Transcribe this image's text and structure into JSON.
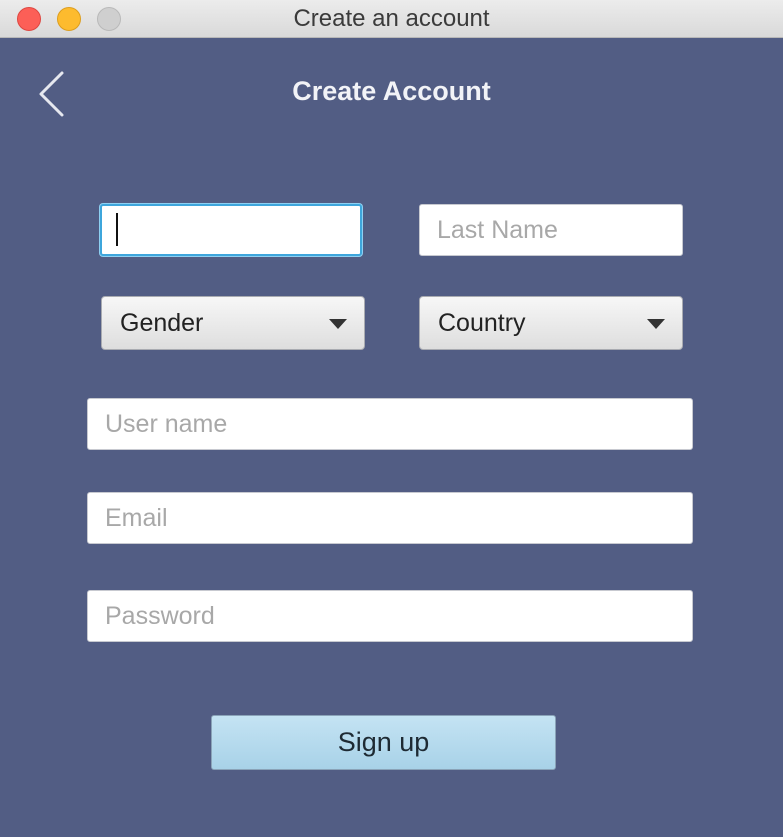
{
  "window": {
    "title": "Create an account"
  },
  "header": {
    "title": "Create Account",
    "back_icon": "chevron-left-icon"
  },
  "form": {
    "first_name": {
      "value": "",
      "placeholder": ""
    },
    "last_name": {
      "value": "",
      "placeholder": "Last Name"
    },
    "gender": {
      "selected": "Gender"
    },
    "country": {
      "selected": "Country"
    },
    "username": {
      "value": "",
      "placeholder": "User name"
    },
    "email": {
      "value": "",
      "placeholder": "Email"
    },
    "password": {
      "value": "",
      "placeholder": "Password"
    },
    "submit_label": "Sign up"
  },
  "colors": {
    "background": "#525d84",
    "focus_ring": "#3ea6dc",
    "button": "#b4dbee"
  }
}
